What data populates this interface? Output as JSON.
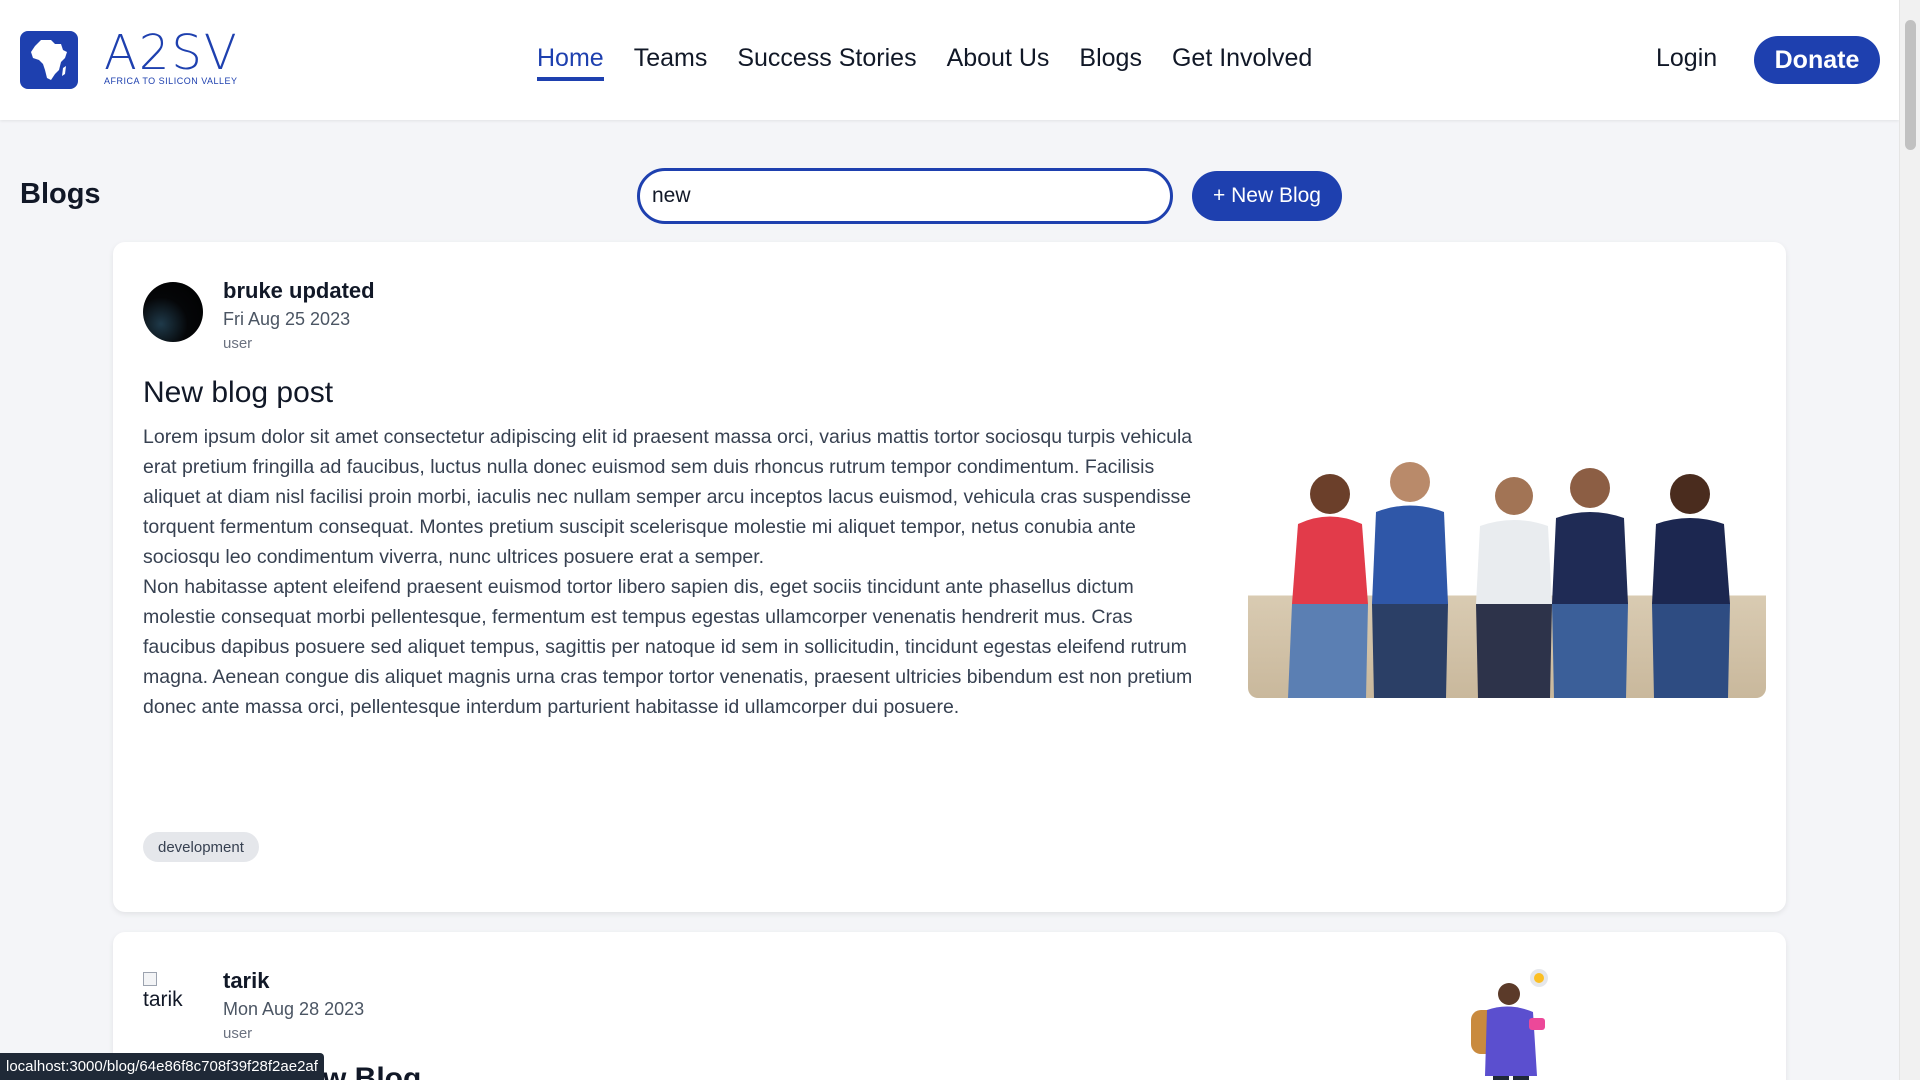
{
  "brand": {
    "name": "A2SV",
    "tagline": "AFRICA TO SILICON VALLEY"
  },
  "nav": {
    "links": [
      "Home",
      "Teams",
      "Success Stories",
      "About Us",
      "Blogs",
      "Get Involved"
    ],
    "active": "Home",
    "login": "Login",
    "donate": "Donate"
  },
  "blogs_page": {
    "title": "Blogs",
    "search_value": "new",
    "new_blog_label": "+ New Blog"
  },
  "posts": [
    {
      "author": "bruke updated",
      "date": "Fri Aug 25 2023",
      "role": "user",
      "title": "New blog post",
      "paragraphs": [
        "Lorem ipsum dolor sit amet consectetur adipiscing elit id praesent massa orci, varius mattis tortor sociosqu turpis vehicula erat pretium fringilla ad faucibus, luctus nulla donec euismod sem duis rhoncus rutrum tempor condimentum. Facilisis aliquet at diam nisl facilisi proin morbi, iaculis nec nullam semper arcu inceptos lacus euismod, vehicula cras suspendisse torquent fermentum consequat. Montes pretium suscipit scelerisque molestie mi aliquet tempor, netus conubia ante sociosqu leo condimentum viverra, nunc ultrices posuere erat a semper.",
        "Non habitasse aptent eleifend praesent euismod tortor libero sapien dis, eget sociis tincidunt ante phasellus dictum molestie consequat morbi pellentesque, fermentum est tempus egestas ullamcorper venenatis hendrerit mus. Cras faucibus dapibus posuere sed aliquet tempus, sagittis per natoque id sem in sollicitudin, tincidunt egestas eleifend rutrum magna. Aenean congue dis aliquet magnis urna cras tempor tortor venenatis, praesent ultricies bibendum est non pretium donec ante massa orci, pellentesque interdum parturient habitasse id ullamcorper dui posuere."
      ],
      "tag": "development"
    },
    {
      "author": "tarik",
      "avatar_alt": "tarik",
      "date": "Mon Aug 28 2023",
      "role": "user",
      "title_fragment": "w Blog"
    }
  ],
  "status_bar": {
    "url": "localhost:3000/blog/64e86f8c708f39f28f2ae2af"
  },
  "colors": {
    "primary": "#1e40af",
    "background": "#f4f5f8",
    "card": "#ffffff",
    "tag_bg": "#e5e7eb"
  }
}
